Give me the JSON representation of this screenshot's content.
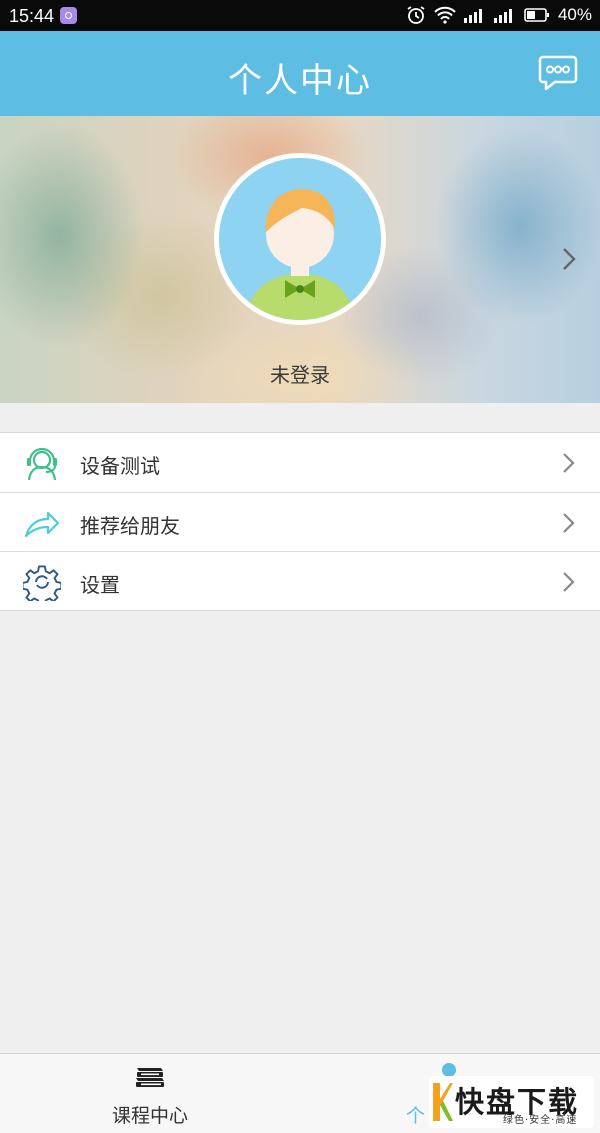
{
  "status_bar": {
    "time": "15:44",
    "battery": "40%"
  },
  "header": {
    "title": "个人中心"
  },
  "profile": {
    "status": "未登录"
  },
  "menu": {
    "items": [
      {
        "label": "设备测试",
        "icon": "headset-user-icon"
      },
      {
        "label": "推荐给朋友",
        "icon": "share-arrow-icon"
      },
      {
        "label": "设置",
        "icon": "gear-icon"
      }
    ]
  },
  "tabs": [
    {
      "label": "课程中心",
      "icon": "books-icon"
    },
    {
      "label": "个",
      "icon": "person-icon"
    }
  ],
  "watermark": {
    "brand": "快盘下载",
    "slogan": "绿色·安全·高速"
  },
  "colors": {
    "accent": "#5ebde2",
    "icon_green": "#3cc08a",
    "icon_blue": "#2e5a8c"
  }
}
